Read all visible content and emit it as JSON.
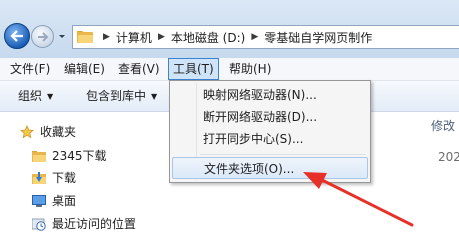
{
  "address_bar": {
    "crumbs": [
      "计算机",
      "本地磁盘 (D:)",
      "零基础自学网页制作"
    ]
  },
  "menu_bar": {
    "items": [
      "文件(F)",
      "编辑(E)",
      "查看(V)",
      "工具(T)",
      "帮助(H)"
    ],
    "active": "工具(T)"
  },
  "toolbar": {
    "organize": "组织",
    "include_in_library": "包含到库中"
  },
  "sidebar": {
    "items": [
      {
        "label": "收藏夹",
        "icon": "star-icon"
      },
      {
        "label": "2345下载",
        "icon": "folder-icon"
      },
      {
        "label": "下载",
        "icon": "download-folder-icon"
      },
      {
        "label": "桌面",
        "icon": "desktop-icon"
      },
      {
        "label": "最近访问的位置",
        "icon": "recent-places-icon"
      }
    ]
  },
  "file_list": {
    "column_header_partial": "修改",
    "first_row_date_partial": "202"
  },
  "tools_menu": {
    "items": [
      "映射网络驱动器(N)...",
      "断开网络驱动器(D)...",
      "打开同步中心(S)...",
      "文件夹选项(O)..."
    ],
    "highlighted": "文件夹选项(O)..."
  },
  "colors": {
    "annotation_arrow": "#e8302a",
    "menu_highlight": "#cfe4f8",
    "titlebar": "#c6d9ee"
  }
}
